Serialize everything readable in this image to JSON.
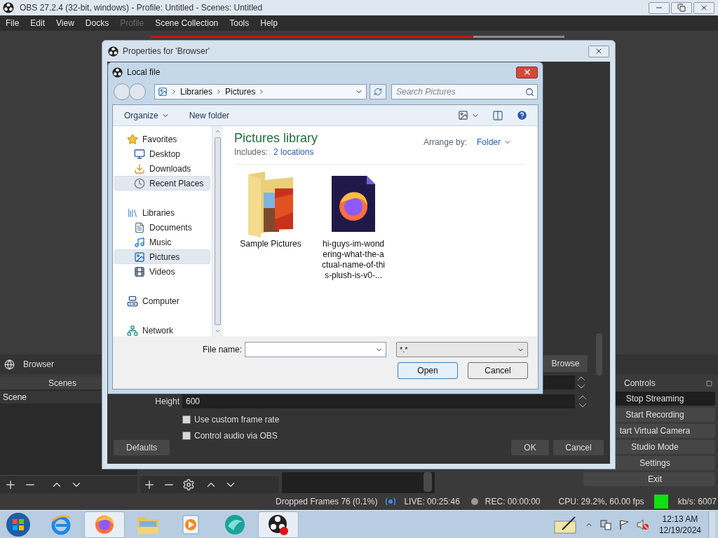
{
  "window": {
    "title": "OBS 27.2.4 (32-bit, windows) - Profile: Untitled - Scenes: Untitled"
  },
  "menu": [
    {
      "label": "File",
      "disabled": false
    },
    {
      "label": "Edit",
      "disabled": false
    },
    {
      "label": "View",
      "disabled": false
    },
    {
      "label": "Docks",
      "disabled": false
    },
    {
      "label": "Profile",
      "disabled": true
    },
    {
      "label": "Scene Collection",
      "disabled": false
    },
    {
      "label": "Tools",
      "disabled": false
    },
    {
      "label": "Help",
      "disabled": false
    }
  ],
  "preview": {
    "level": 0.78
  },
  "source_bar": {
    "name": "Browser"
  },
  "scenes": {
    "title": "Scenes",
    "items": [
      {
        "label": "Scene",
        "selected": true
      }
    ]
  },
  "controls": {
    "title": "Controls",
    "buttons": [
      {
        "label": "Stop Streaming",
        "highlighted": true
      },
      {
        "label": "Start Recording",
        "highlighted": false
      },
      {
        "label": "tart Virtual Camera",
        "highlighted": false
      },
      {
        "label": "Studio Mode",
        "highlighted": false
      },
      {
        "label": "Settings",
        "highlighted": false
      },
      {
        "label": "Exit",
        "highlighted": false
      }
    ]
  },
  "properties": {
    "title": "Properties for 'Browser'",
    "browse": "Browse",
    "height_label": "Height",
    "height_value": "600",
    "checkboxes": [
      {
        "label": "Use custom frame rate",
        "checked": false
      },
      {
        "label": "Control audio via OBS",
        "checked": false
      }
    ],
    "defaults": "Defaults",
    "ok": "OK",
    "cancel": "Cancel"
  },
  "file_dialog": {
    "title": "Local file",
    "breadcrumb": [
      "Libraries",
      "Pictures"
    ],
    "search": {
      "placeholder": "Search Pictures"
    },
    "organize": "Organize",
    "new_folder": "New folder",
    "nav": [
      {
        "label": "Favorites",
        "kind": "star",
        "selected": false,
        "children": [
          {
            "label": "Desktop",
            "kind": "desktop",
            "selected": false
          },
          {
            "label": "Downloads",
            "kind": "downloads",
            "selected": false
          },
          {
            "label": "Recent Places",
            "kind": "recent",
            "selected": true
          }
        ]
      },
      {
        "label": "Libraries",
        "kind": "libraries",
        "selected": false,
        "children": [
          {
            "label": "Documents",
            "kind": "documents",
            "selected": false
          },
          {
            "label": "Music",
            "kind": "music",
            "selected": false
          },
          {
            "label": "Pictures",
            "kind": "pictures",
            "selected": true
          },
          {
            "label": "Videos",
            "kind": "videos",
            "selected": false
          }
        ]
      },
      {
        "label": "Computer",
        "kind": "computer",
        "selected": false
      },
      {
        "label": "Network",
        "kind": "network",
        "selected": false
      }
    ],
    "library_title": "Pictures library",
    "includes_label": "Includes:",
    "includes_link": "2 locations",
    "arrange_label": "Arrange by:",
    "arrange_value": "Folder",
    "files": [
      {
        "name": "Sample Pictures",
        "kind": "folder"
      },
      {
        "name": "hi-guys-im-wondering-what-the-actual-name-of-this-plush-is-v0-...",
        "kind": "firefox-file"
      }
    ],
    "file_name_label": "File name:",
    "filter": "*.*",
    "open": "Open",
    "cancel": "Cancel"
  },
  "status": {
    "dropped": "Dropped Frames 76 (0.1%)",
    "live": "LIVE: 00:25:46",
    "rec": "REC: 00:00:00",
    "cpu": "CPU: 29.2%, 60.00 fps",
    "kbps": "kb/s: 6007"
  },
  "taskbar": {
    "apps": [
      {
        "kind": "ie",
        "active": false
      },
      {
        "kind": "firefox",
        "active": true
      },
      {
        "kind": "explorer",
        "active": false
      },
      {
        "kind": "media",
        "active": false
      },
      {
        "kind": "teal-app",
        "active": false
      },
      {
        "kind": "obs",
        "active": true
      }
    ],
    "time": "12:13 AM",
    "date": "12/19/2024"
  }
}
